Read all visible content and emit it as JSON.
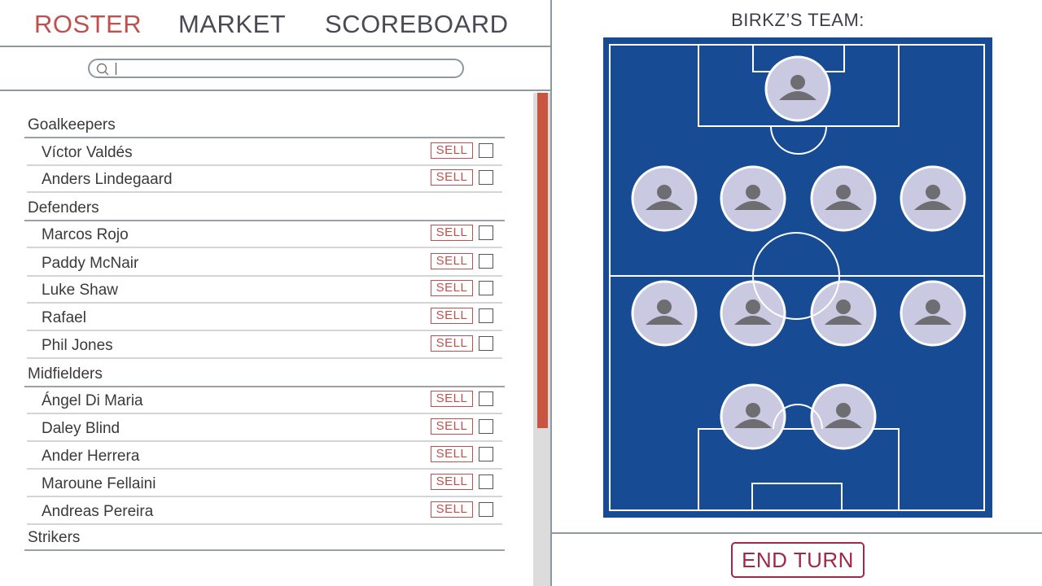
{
  "tabs": {
    "roster": "ROSTER",
    "market": "MARKET",
    "scoreboard": "SCOREBOARD",
    "active": "roster",
    "active_color": "#c0504d"
  },
  "search": {
    "value": "",
    "placeholder": ""
  },
  "roster": {
    "sell_label": "SELL",
    "groups": [
      {
        "name": "Goalkeepers",
        "players": [
          "Víctor Valdés",
          "Anders Lindegaard"
        ]
      },
      {
        "name": "Defenders",
        "players": [
          "Marcos Rojo",
          "Paddy McNair",
          "Luke Shaw",
          "Rafael",
          "Phil Jones"
        ]
      },
      {
        "name": "Midfielders",
        "players": [
          "Ángel Di Maria",
          "Daley Blind",
          "Ander Herrera",
          "Maroune Fellaini",
          "Andreas Pereira"
        ]
      },
      {
        "name": "Strikers",
        "players": []
      }
    ]
  },
  "team": {
    "title": "BIRKZ’S TEAM:",
    "pitch_color": "#174c94",
    "line_color": "#ffffff",
    "avatar_color": "#c9c9e2",
    "avatar_icon_color": "#6d6d72",
    "formation": [
      1,
      4,
      4,
      2
    ]
  },
  "end_turn": {
    "label": "END TURN",
    "color": "#a0294a"
  },
  "scrollbar": {
    "thumb_color": "#c8553f"
  }
}
